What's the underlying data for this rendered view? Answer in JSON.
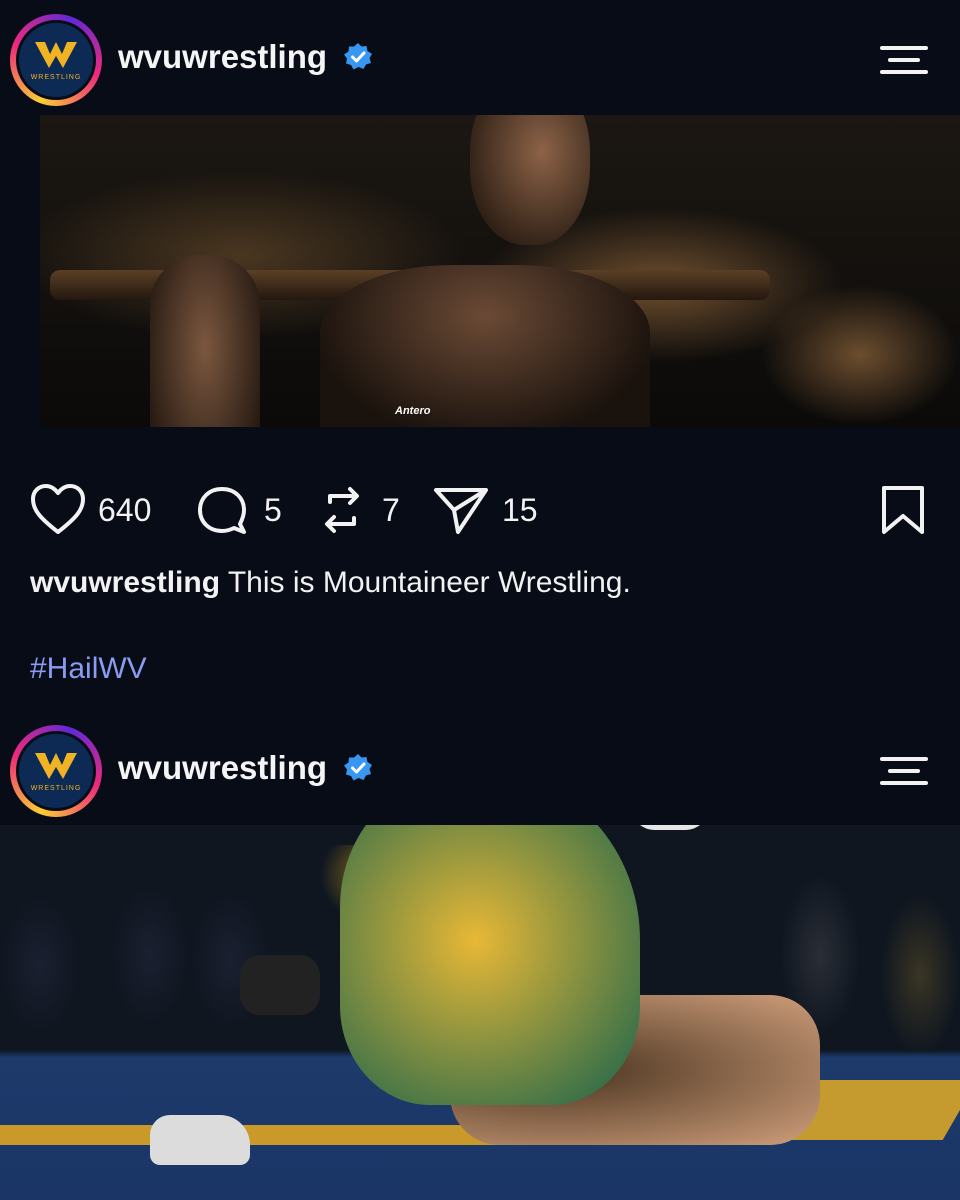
{
  "posts": [
    {
      "username": "wvuwrestling",
      "avatar_text": "WRESTLING",
      "photo_logo_text": "Antero",
      "likes": "640",
      "comments": "5",
      "reposts": "7",
      "shares": "15",
      "caption_user": "wvuwrestling",
      "caption_text": " This is Mountaineer Wrestling.",
      "hashtag": "#HailWV"
    },
    {
      "username": "wvuwrestling",
      "avatar_text": "WRESTLING"
    }
  ],
  "colors": {
    "background": "#080c17",
    "verified": "#3897f0",
    "hashtag": "#8a9cf2",
    "wvu_blue": "#0d2a55",
    "wvu_gold": "#f0b323"
  },
  "icons": {
    "like": "heart-icon",
    "comment": "comment-icon",
    "repost": "repost-icon",
    "share": "send-icon",
    "save": "bookmark-icon",
    "menu": "menu-icon",
    "verified": "verified-badge-icon"
  }
}
